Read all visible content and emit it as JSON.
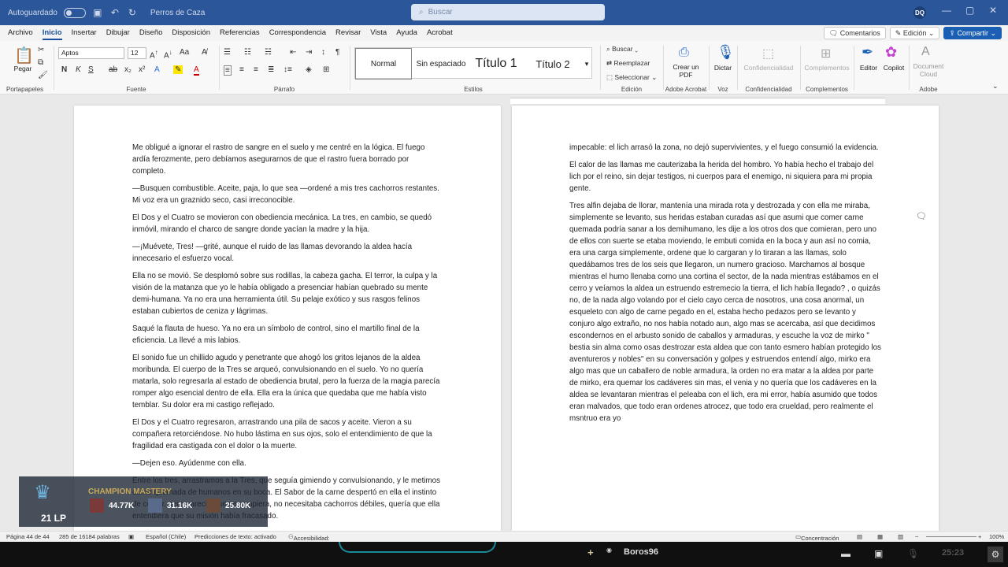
{
  "titlebar": {
    "autosave_label": "Autoguardado",
    "doc_title": "Perros de Caza",
    "search_placeholder": "Buscar",
    "avatar_initials": "DQ"
  },
  "menu": {
    "tabs": [
      "Archivo",
      "Inicio",
      "Insertar",
      "Dibujar",
      "Diseño",
      "Disposición",
      "Referencias",
      "Correspondencia",
      "Revisar",
      "Vista",
      "Ayuda",
      "Acrobat"
    ],
    "active_tab": "Inicio",
    "comments_label": "Comentarios",
    "edit_label": "Edición",
    "share_label": "Compartir"
  },
  "ribbon": {
    "paste_label": "Pegar",
    "clipboard_label": "Portapapeles",
    "font_name": "Aptos",
    "font_size": "12",
    "font_label": "Fuente",
    "paragraph_label": "Párrafo",
    "styles": [
      "Normal",
      "Sin espaciado",
      "Título 1",
      "Título 2"
    ],
    "styles_label": "Estilos",
    "find_label": "Buscar",
    "replace_label": "Reemplazar",
    "select_label": "Seleccionar",
    "editing_label": "Edición",
    "create_pdf_label": "Crear un PDF",
    "acrobat_label": "Adobe Acrobat",
    "dictate_label": "Dictar",
    "voice_label": "Voz",
    "confidentiality_label": "Confidencialidad",
    "confidentiality_group": "Confidencialidad",
    "complements_label": "Complementos",
    "complements_group": "Complementos",
    "editor_label": "Editor",
    "copilot_label": "Copilot",
    "document_cloud_label": "Document Cloud",
    "adobe_group": "Adobe"
  },
  "left_page": {
    "paragraphs": [
      "Me obligué a ignorar el rastro de sangre en el suelo y me centré en la lógica. El fuego ardía ferozmente, pero debíamos asegurarnos de que el rastro fuera borrado por completo.",
      "—Busquen combustible. Aceite, paja, lo que sea —ordené a mis tres cachorros restantes. Mi voz era un graznido seco, casi irreconocible.",
      "El Dos y el Cuatro se movieron con obediencia mecánica. La tres, en cambio, se quedó inmóvil, mirando el charco de sangre donde yacían la madre y la hija.",
      "—¡Muévete, Tres! —grité, aunque el ruido de las llamas devorando la aldea hacía innecesario el esfuerzo vocal.",
      "Ella no se movió. Se desplomó sobre sus rodillas, la cabeza gacha. El terror, la culpa y la visión de la matanza que yo le había obligado a presenciar habían quebrado su mente demi-humana. Ya no era una herramienta útil. Su pelaje exótico y sus rasgos felinos estaban cubiertos de ceniza y lágrimas.",
      "Saqué la flauta de hueso. Ya no era un símbolo de control, sino el martillo final de la eficiencia. La llevé a mis labios.",
      "El sonido fue un chillido agudo y penetrante que ahogó los gritos lejanos de la aldea moribunda. El cuerpo de la Tres se arqueó, convulsionando en el suelo. Yo no quería matarla, solo regresarla al estado de obediencia brutal, pero la fuerza de la magia parecía romper algo esencial dentro de ella. Ella era la única que quedaba que me había visto temblar. Su dolor era mi castigo reflejado.",
      "El Dos y el Cuatro regresaron, arrastrando una pila de sacos y aceite. Vieron a su compañera retorciéndose. No hubo lástima en sus ojos, solo el entendimiento de que la fragilidad era castigada con el dolor o la muerte.",
      "—Dejen eso. Ayúdenme con ella.",
      "Entre los tres, arrastramos a la Tres, que seguía gimiendo y convulsionando, y le metimos carne quemada de humanos en su boca. El Sabor de la carne despertó en ella el instinto de comer, pero parecía que se rompiera, no necesitaba cachorros débiles, quería que ella entendiera que su misión había fracasado."
    ]
  },
  "right_page": {
    "paragraphs": [
      "impecable: el lich arrasó la zona, no dejó supervivientes, y el fuego consumió la evidencia.",
      "El calor de las llamas me cauterizaba la herida del hombro. Yo había hecho el trabajo del lich por el reino, sin dejar testigos, ni cuerpos para el enemigo, ni siquiera para mi propia gente.",
      "Tres alfin dejaba de llorar, mantenía una mirada rota y destrozada y con ella me miraba, simplemente se levanto, sus heridas estaban curadas así que asumi que comer carne quemada podría sanar a los demihumano, les dije a los otros dos que comieran, pero uno de ellos con suerte se etaba moviendo, le embuti comida en la boca y aun así no comia, era una carga simplemente, ordene que lo cargaran y lo tiraran a las llamas, solo quedábamos tres de los seis que llegaron, un numero gracioso. Marchamos al bosque mientras el humo llenaba como una cortina el sector, de la nada mientras estábamos en el cerro y veíamos la aldea un estruendo estremecio la tierra, el lich había llegado? , o quizás no, de la nada algo volando por el cielo cayo cerca de nosotros, una cosa anormal, un esqueleto con algo de carne pegado en el, estaba hecho pedazos pero se levanto y conjuro algo extraño, no nos había notado aun, algo mas se acercaba, así que decidimos escondernos en el arbusto sonido de caballos y armaduras, y escuche la voz de mirko \" bestia sin alma como osas destrozar esta aldea que con tanto esmero habían protegido los aventureros y nobles\" en su conversación y golpes y estruendos entendí algo, mirko era algo mas que un caballero de noble armadura, la orden no era matar a la aldea por parte de mirko, era quemar los cadáveres sin mas, el venia y no quería que los cadáveres en la aldea se levantaran mientras el peleaba con el lich, era mi error, había asumido que todos eran malvados, que todo eran ordenes atrocez, que todo era crueldad, pero realmente el msntruo era yo"
    ]
  },
  "statusbar": {
    "page": "Página 44 de 44",
    "words": "285 de 16184 palabras",
    "language": "Español (Chile)",
    "predictions": "Predicciones de texto: activado",
    "accessibility": "Accesibilidad: todo correcto",
    "focus": "Concentración",
    "zoom": "100%"
  },
  "overlay": {
    "title": "CHAMPION MASTERY",
    "lp": "21 LP",
    "stat1": "44.77K",
    "stat2": "31.16K",
    "stat3": "25.80K"
  },
  "taskbar": {
    "player": "Boros96",
    "time": "25:23"
  }
}
